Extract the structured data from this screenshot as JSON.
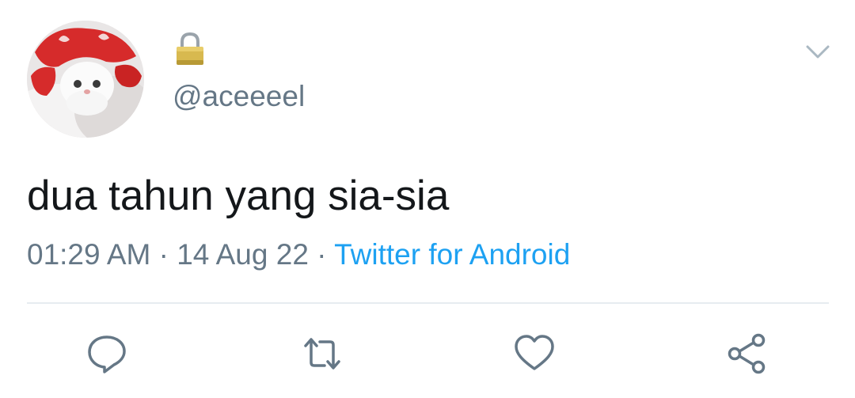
{
  "tweet": {
    "handle": "@aceeeel",
    "protected_icon": "lock-icon",
    "text": "dua tahun yang sia-sia",
    "time": "01:29 AM",
    "separator": " · ",
    "date": "14 Aug 22",
    "source": "Twitter for Android"
  },
  "actions": {
    "reply": "comment-icon",
    "retweet": "retweet-icon",
    "like": "heart-icon",
    "share": "share-icon",
    "menu": "chevron-down-icon"
  },
  "colors": {
    "text": "#14171a",
    "muted": "#657786",
    "link": "#1da1f2",
    "divider": "#e6ecf0"
  }
}
